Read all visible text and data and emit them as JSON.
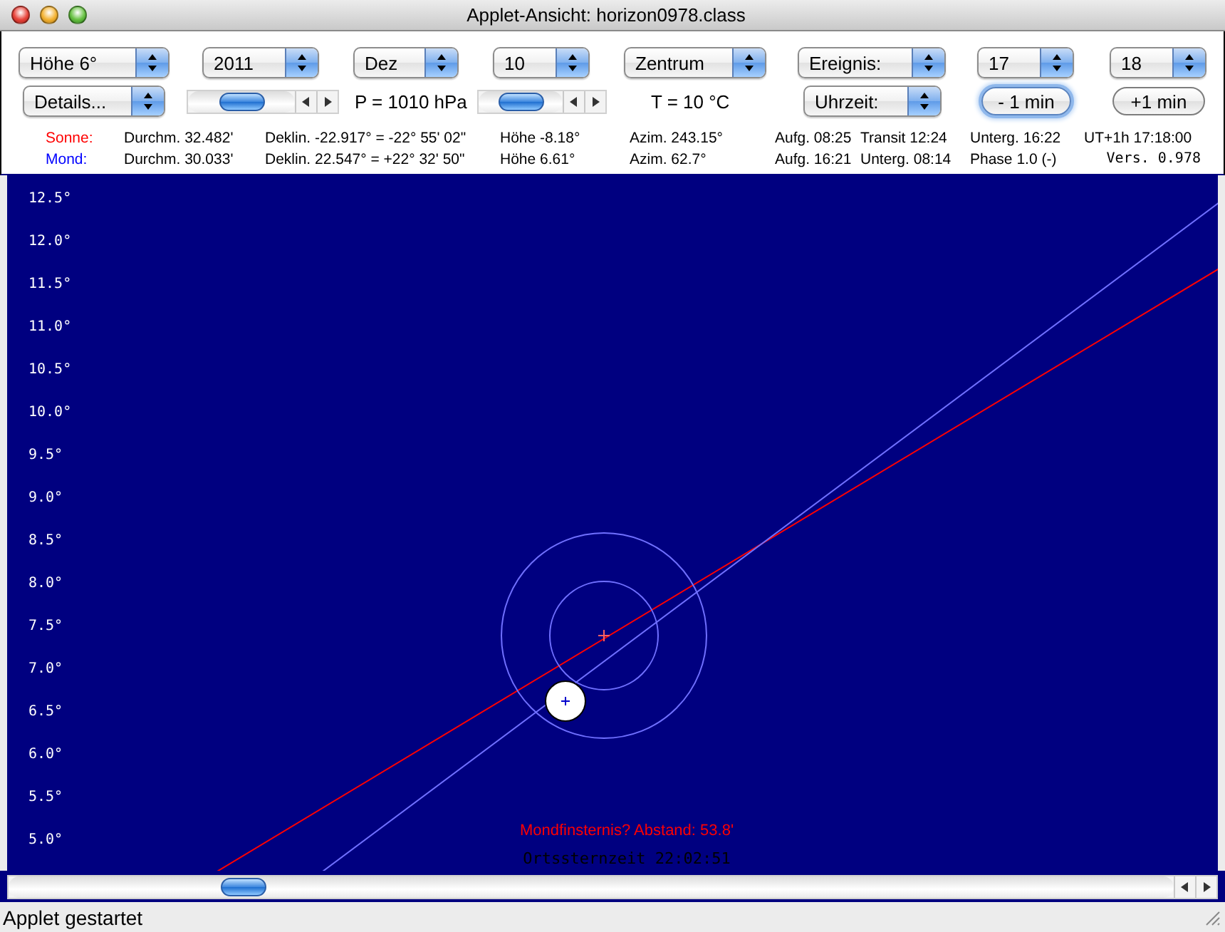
{
  "window": {
    "title": "Applet-Ansicht: horizon0978.class"
  },
  "controls_row_1": [
    {
      "kind": "select",
      "value": "Höhe 6°"
    },
    {
      "kind": "select",
      "value": "2011"
    },
    {
      "kind": "select",
      "value": "Dez"
    },
    {
      "kind": "select",
      "value": "10"
    },
    {
      "kind": "select",
      "value": "Zentrum"
    },
    {
      "kind": "select",
      "value": "Ereignis:"
    },
    {
      "kind": "select",
      "value": "17"
    },
    {
      "kind": "select",
      "value": "18"
    }
  ],
  "controls_row_2": [
    {
      "kind": "select",
      "value": "Details..."
    },
    {
      "kind": "slider",
      "level": 0.5
    },
    {
      "kind": "label",
      "text": "P = 1010 hPa"
    },
    {
      "kind": "slider",
      "level": 0.5
    },
    {
      "kind": "label",
      "text": "T = 10 °C"
    },
    {
      "kind": "select",
      "value": "Uhrzeit:"
    },
    {
      "kind": "button",
      "label": "- 1 min",
      "focused": true
    },
    {
      "kind": "button",
      "label": "+1 min",
      "focused": false
    }
  ],
  "info_rows": [
    {
      "label": "Sonne:",
      "color": "#ff0000",
      "cells": [
        "Durchm. 32.482'",
        "Deklin. -22.917° = -22° 55' 02\"",
        "Höhe -8.18°",
        "Azim. 243.15°",
        "Aufg. 08:25",
        "Transit 12:24",
        "Unterg. 16:22",
        "UT+1h  17:18:00"
      ]
    },
    {
      "label": "Mond:",
      "color": "#0000ff",
      "cells": [
        "Durchm. 30.033'",
        "Deklin. 22.547° = +22° 32' 50\"",
        "Höhe 6.61°",
        "Azim. 62.7°",
        "Aufg. 16:21",
        "Unterg. 08:14",
        "Phase 1.0 (-)",
        "Vers. 0.978"
      ]
    }
  ],
  "plot": {
    "axis_labels": [
      "12.5°",
      "12.0°",
      "11.5°",
      "11.0°",
      "10.5°",
      "10.0°",
      "9.5°",
      "9.0°",
      "8.5°",
      "8.0°",
      "7.5°",
      "7.0°",
      "6.5°",
      "6.0°",
      "5.5°",
      "5.0°"
    ],
    "notice": "Mondfinsternis? Abstand: 53.8'",
    "sidereal_time": "Ortssternzeit 22:02:51"
  },
  "time_scrollbar": {
    "level": 0.19
  },
  "status_bar": "Applet gestartet"
}
